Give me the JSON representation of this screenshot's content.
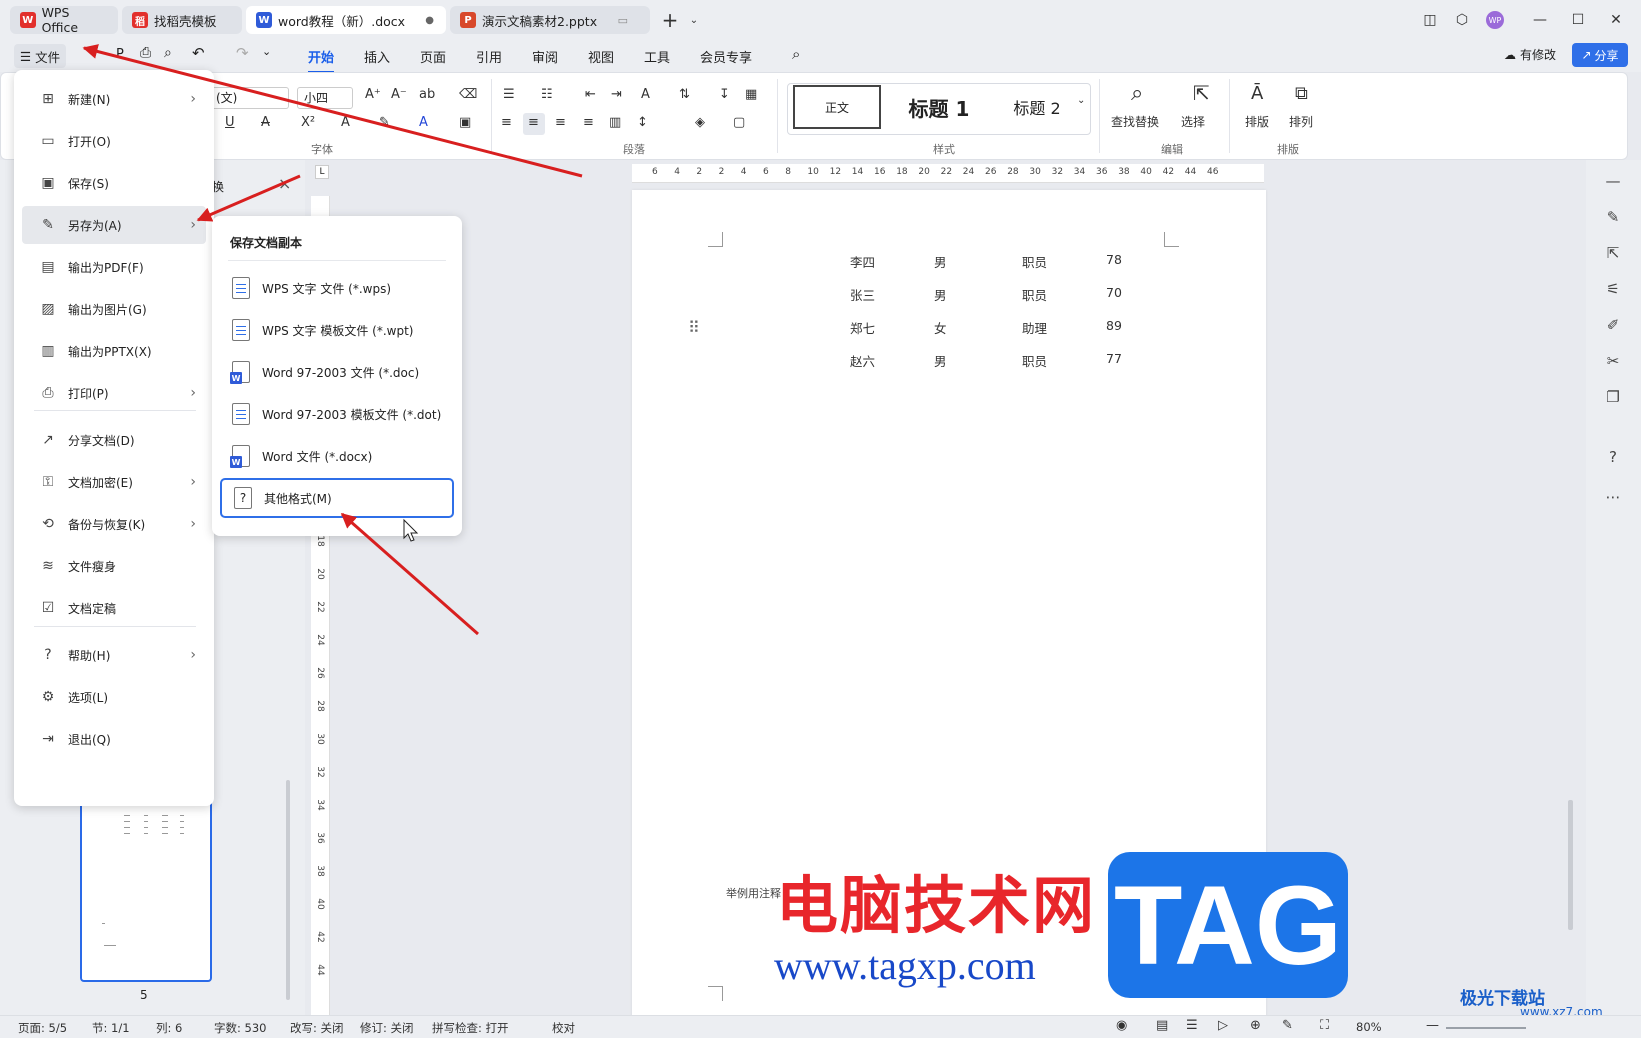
{
  "tabs": [
    {
      "label": "WPS Office",
      "color": "#e2302c",
      "icon": "W"
    },
    {
      "label": "找稻壳模板",
      "color": "#e2302c",
      "icon": "稻"
    },
    {
      "label": "word教程（新）.docx",
      "color": "#2f5bd8",
      "icon": "W"
    },
    {
      "label": "演示文稿素材2.pptx",
      "color": "#d8482a",
      "icon": "P"
    }
  ],
  "window": {
    "avatar": "WP",
    "min": "—",
    "max": "☐",
    "close": "✕"
  },
  "menubar": {
    "file_label": "文件",
    "tabs": [
      "开始",
      "插入",
      "页面",
      "引用",
      "审阅",
      "视图",
      "工具",
      "会员专享"
    ],
    "selected": "开始",
    "modify_label": "有修改",
    "share_label": "分享"
  },
  "ribbon": {
    "font_name": "(文)",
    "font_size": "小四",
    "group_labels": {
      "font": "字体",
      "paragraph": "段落",
      "style": "样式",
      "edit": "编辑",
      "arrange": "排版"
    },
    "styles": [
      "正文",
      "标题 1",
      "标题 2"
    ],
    "find_label": "查找替换",
    "select_label": "选择",
    "layout_label": "排版",
    "arrange_label": "排列"
  },
  "ruler_h": [
    "6",
    "4",
    "2",
    "2",
    "4",
    "6",
    "8",
    "10",
    "12",
    "14",
    "16",
    "18",
    "20",
    "22",
    "24",
    "26",
    "28",
    "30",
    "32",
    "34",
    "36",
    "38",
    "40",
    "42",
    "44",
    "46"
  ],
  "ruler_v": [
    "18",
    "20",
    "22",
    "24",
    "26",
    "28",
    "30",
    "32",
    "34",
    "36",
    "38",
    "40",
    "42",
    "44"
  ],
  "table_rows": [
    [
      "李四",
      "男",
      "职员",
      "78"
    ],
    [
      "张三",
      "男",
      "职员",
      "70"
    ],
    [
      "郑七",
      "女",
      "助理",
      "89"
    ],
    [
      "赵六",
      "男",
      "职员",
      "77"
    ]
  ],
  "footnote": "举例用注释",
  "nav": {
    "close": "×",
    "page_number": "5",
    "tab_char": "换"
  },
  "file_menu": [
    {
      "label": "新建(N)",
      "icon": "new-icon",
      "chev": true
    },
    {
      "label": "打开(O)",
      "icon": "folder-icon",
      "chev": false
    },
    {
      "label": "保存(S)",
      "icon": "save-icon",
      "chev": false
    },
    {
      "label": "另存为(A)",
      "icon": "save-as-icon",
      "chev": true
    },
    {
      "label": "输出为PDF(F)",
      "icon": "pdf-icon",
      "chev": false
    },
    {
      "label": "输出为图片(G)",
      "icon": "image-icon",
      "chev": false
    },
    {
      "label": "输出为PPTX(X)",
      "icon": "pptx-icon",
      "chev": false
    },
    {
      "label": "打印(P)",
      "icon": "print-icon",
      "chev": true
    },
    {
      "label": "分享文档(D)",
      "icon": "share-icon",
      "chev": false
    },
    {
      "label": "文档加密(E)",
      "icon": "lock-icon",
      "chev": true
    },
    {
      "label": "备份与恢复(K)",
      "icon": "backup-icon",
      "chev": true
    },
    {
      "label": "文件瘦身",
      "icon": "slim-icon",
      "chev": false
    },
    {
      "label": "文档定稿",
      "icon": "finalize-icon",
      "chev": false
    },
    {
      "label": "帮助(H)",
      "icon": "help-icon",
      "chev": true
    },
    {
      "label": "选项(L)",
      "icon": "options-icon",
      "chev": false
    },
    {
      "label": "退出(Q)",
      "icon": "exit-icon",
      "chev": false
    }
  ],
  "submenu": {
    "title": "保存文档副本",
    "items": [
      {
        "label": "WPS 文字 文件 (*.wps)",
        "type": "doc"
      },
      {
        "label": "WPS 文字 模板文件 (*.wpt)",
        "type": "doc"
      },
      {
        "label": "Word 97-2003 文件 (*.doc)",
        "type": "word"
      },
      {
        "label": "Word 97-2003 模板文件 (*.dot)",
        "type": "doc"
      },
      {
        "label": "Word 文件 (*.docx)",
        "type": "word"
      },
      {
        "label": "其他格式(M)",
        "type": "other"
      }
    ]
  },
  "status": {
    "page": "页面: 5/5",
    "section": "节: 1/1",
    "column": "列: 6",
    "words": "字数: 530",
    "rewrite": "改写: 关闭",
    "revision": "修订: 关闭",
    "spell": "拼写检查: 打开",
    "proof": "校对",
    "zoom": "80%"
  },
  "watermark": {
    "cn": "电脑技术网",
    "url": "www.tagxp.com",
    "tag": "TAG",
    "site": "极光下载站",
    "site_url": "www.xz7.com"
  }
}
